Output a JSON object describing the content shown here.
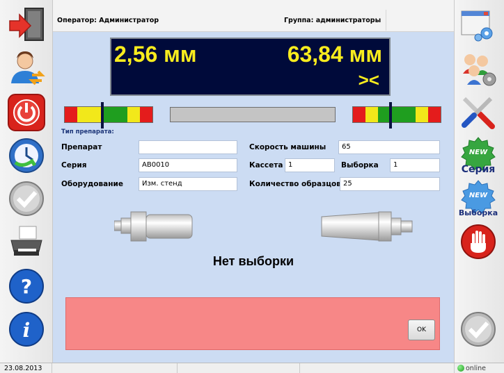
{
  "header": {
    "operator_label": "Оператор:",
    "operator_value": "Администратор",
    "group_label": "Группа:",
    "group_value": "администраторы"
  },
  "display": {
    "value_left": "2,56 мм",
    "value_right": "63,84 мм",
    "comparison": "><"
  },
  "colors": {
    "display_bg": "#000a3a",
    "display_text": "#f8ec1e",
    "panel_bg": "#ccdcf3",
    "message_bg": "#f78787"
  },
  "scales": {
    "left_segments": [
      "#e41c1c",
      "#f2e81a",
      "#f2e81a",
      "#1f9e1f",
      "#1f9e1f",
      "#f2e81a",
      "#e41c1c"
    ],
    "right_segments": [
      "#e41c1c",
      "#f2e81a",
      "#1f9e1f",
      "#1f9e1f",
      "#1f9e1f",
      "#f2e81a",
      "#e41c1c"
    ]
  },
  "form": {
    "caption": "Тип препарата:",
    "preparat_label": "Препарат",
    "preparat_value": "",
    "series_label": "Серия",
    "series_value": "AB0010",
    "equipment_label": "Оборудование",
    "equipment_value": "Изм. стенд",
    "speed_label": "Скорость машины",
    "speed_value": "65",
    "cassette_label": "Кассета",
    "cassette_value": "1",
    "sample_label": "Выборка",
    "sample_value": "1",
    "count_label": "Количество образцов",
    "count_value": "25"
  },
  "status_message": "Нет выборки",
  "dialog": {
    "ok_label": "OK"
  },
  "toolbar_left": [
    "exit-icon",
    "switch-user-icon",
    "power-icon",
    "clock-refresh-icon",
    "checkmark-icon",
    "printer-icon",
    "help-icon",
    "info-icon"
  ],
  "toolbar_right": {
    "items": [
      "window-settings-icon",
      "users-settings-icon",
      "tools-icon",
      "new-series-icon",
      "new-sample-icon",
      "stop-hand-icon",
      "checkmark-icon"
    ],
    "new_badge": "NEW",
    "new_series_label": "Серия",
    "new_sample_label": "Выборка"
  },
  "statusbar": {
    "date": "23.08.2013",
    "connection": "online"
  }
}
